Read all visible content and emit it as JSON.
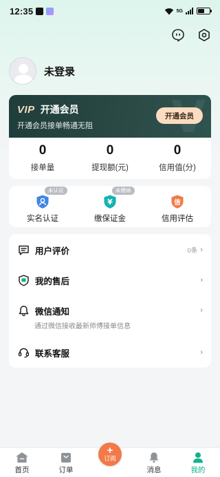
{
  "status_bar": {
    "time": "12:35",
    "network": "5G",
    "battery_level": 0.55
  },
  "header": {
    "icons": [
      "chat-bubble-icon",
      "settings-icon"
    ]
  },
  "profile": {
    "name": "未登录"
  },
  "vip": {
    "logo": "VIP",
    "title": "开通会员",
    "subtitle": "开通会员接单畅通无阻",
    "button": "开通会员",
    "colors": {
      "card": "#1f3d3a",
      "button": "#fbdcc0"
    }
  },
  "stats": [
    {
      "value": "0",
      "label": "接单量"
    },
    {
      "value": "0",
      "label": "提现额(元)"
    },
    {
      "value": "0",
      "label": "信用值(分)"
    }
  ],
  "services": [
    {
      "label": "实名认证",
      "badge": "未认证",
      "icon": "shield-person-icon"
    },
    {
      "label": "缴保证金",
      "badge": "未缴纳",
      "icon": "yuan-shield-icon"
    },
    {
      "label": "信用评估",
      "badge": "",
      "icon": "credit-shield-icon",
      "icon_text": "信"
    }
  ],
  "menu": [
    {
      "title": "用户评价",
      "right": "0条",
      "icon": "message-square-icon"
    },
    {
      "title": "我的售后",
      "right": "",
      "icon": "after-sales-shield-icon"
    },
    {
      "title": "微信通知",
      "right": "",
      "subtitle": "通过微信接收最新师傅接单信息",
      "icon": "bell-icon"
    },
    {
      "title": "联系客服",
      "right": "",
      "icon": "headset-icon"
    }
  ],
  "bottom_nav": [
    {
      "label": "首页",
      "icon": "home-icon"
    },
    {
      "label": "订单",
      "icon": "order-bag-icon"
    },
    {
      "label": "订阅",
      "icon": "plus-icon",
      "plus": "+"
    },
    {
      "label": "消息",
      "icon": "bell-nav-icon"
    },
    {
      "label": "我的",
      "icon": "person-icon",
      "active": true
    }
  ],
  "colors": {
    "accent": "#12b38a",
    "orange": "#f27a48",
    "blue": "#3f86e6",
    "teal": "#12b3b0"
  }
}
